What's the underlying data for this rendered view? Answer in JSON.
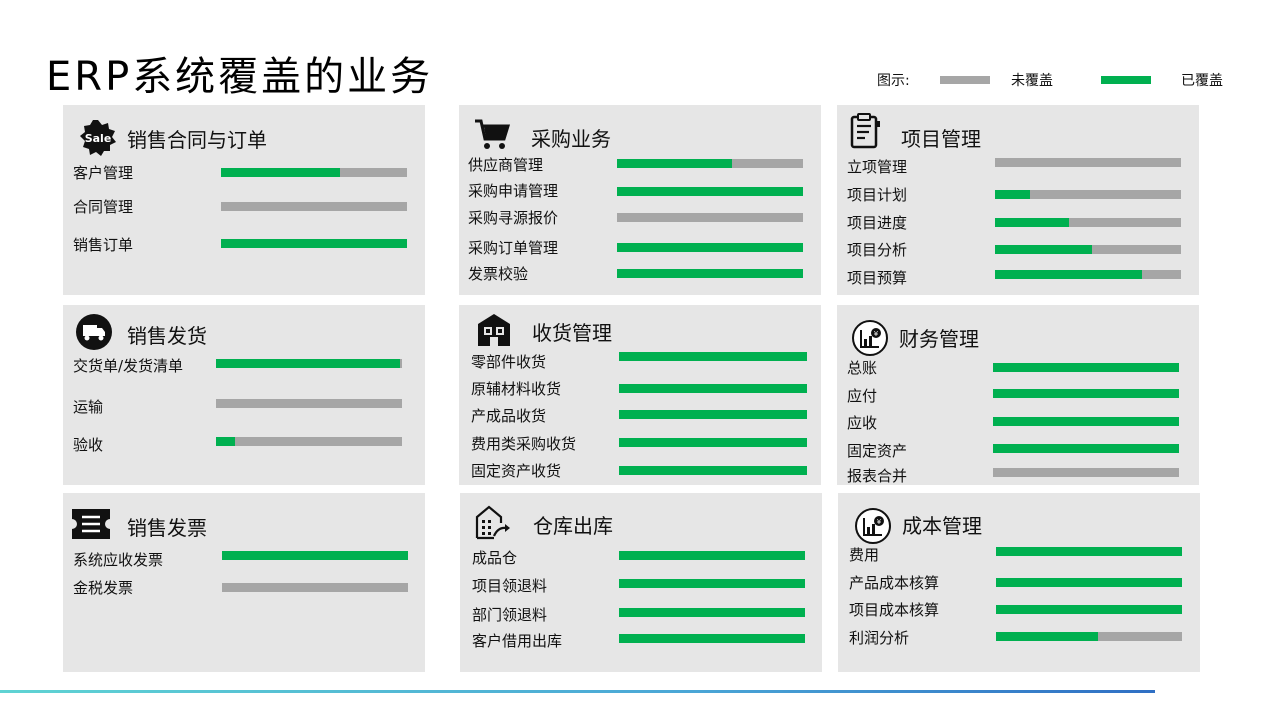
{
  "page": {
    "title": "ERP系统覆盖的业务"
  },
  "legend": {
    "label": "图示:",
    "uncovered": "未覆盖",
    "covered": "已覆盖",
    "uncovered_color": "#a6a6a6",
    "covered_color": "#00b050"
  },
  "cards": [
    {
      "id": "sales-contract",
      "icon": "sale-badge-icon",
      "title": "销售合同与订单",
      "rows": [
        {
          "label": "客户管理",
          "coverage": 0.64
        },
        {
          "label": "合同管理",
          "coverage": 0.0
        },
        {
          "label": "销售订单",
          "coverage": 1.0
        }
      ]
    },
    {
      "id": "purchasing",
      "icon": "shopping-cart-icon",
      "title": "采购业务",
      "rows": [
        {
          "label": "供应商管理",
          "coverage": 0.62
        },
        {
          "label": "采购申请管理",
          "coverage": 1.0
        },
        {
          "label": "采购寻源报价",
          "coverage": 0.0
        },
        {
          "label": "采购订单管理",
          "coverage": 1.0
        },
        {
          "label": "发票校验",
          "coverage": 1.0
        }
      ]
    },
    {
      "id": "project",
      "icon": "document-list-icon",
      "title": "项目管理",
      "rows": [
        {
          "label": "立项管理",
          "coverage": 0.0
        },
        {
          "label": "项目计划",
          "coverage": 0.19
        },
        {
          "label": "项目进度",
          "coverage": 0.4
        },
        {
          "label": "项目分析",
          "coverage": 0.52
        },
        {
          "label": "项目预算",
          "coverage": 0.79
        }
      ]
    },
    {
      "id": "sales-delivery",
      "icon": "truck-icon",
      "title": "销售发货",
      "rows": [
        {
          "label": "交货单/发货清单",
          "coverage": 0.99
        },
        {
          "label": "运输",
          "coverage": 0.0
        },
        {
          "label": "验收",
          "coverage": 0.1
        }
      ]
    },
    {
      "id": "receiving",
      "icon": "warehouse-boxes-icon",
      "title": "收货管理",
      "rows": [
        {
          "label": "零部件收货",
          "coverage": 1.0
        },
        {
          "label": "原辅材料收货",
          "coverage": 1.0
        },
        {
          "label": "产成品收货",
          "coverage": 1.0
        },
        {
          "label": "费用类采购收货",
          "coverage": 1.0
        },
        {
          "label": "固定资产收货",
          "coverage": 1.0
        }
      ]
    },
    {
      "id": "finance",
      "icon": "finance-chart-icon",
      "title": "财务管理",
      "rows": [
        {
          "label": "总账",
          "coverage": 1.0
        },
        {
          "label": "应付",
          "coverage": 1.0
        },
        {
          "label": "应收",
          "coverage": 1.0
        },
        {
          "label": "固定资产",
          "coverage": 1.0
        },
        {
          "label": "报表合并",
          "coverage": 0.0
        }
      ]
    },
    {
      "id": "sales-invoice",
      "icon": "ticket-icon",
      "title": "销售发票",
      "rows": [
        {
          "label": "系统应收发票",
          "coverage": 1.0
        },
        {
          "label": "金税发票",
          "coverage": 0.0
        }
      ]
    },
    {
      "id": "warehouse-out",
      "icon": "building-arrow-icon",
      "title": "仓库出库",
      "rows": [
        {
          "label": "成品仓",
          "coverage": 1.0
        },
        {
          "label": "项目领退料",
          "coverage": 1.0
        },
        {
          "label": "部门领退料",
          "coverage": 1.0
        },
        {
          "label": "客户借用出库",
          "coverage": 1.0
        }
      ]
    },
    {
      "id": "cost",
      "icon": "finance-chart-icon",
      "title": "成本管理",
      "rows": [
        {
          "label": "费用",
          "coverage": 1.0
        },
        {
          "label": "产品成本核算",
          "coverage": 1.0
        },
        {
          "label": "项目成本核算",
          "coverage": 1.0
        },
        {
          "label": "利润分析",
          "coverage": 0.55
        }
      ]
    }
  ]
}
